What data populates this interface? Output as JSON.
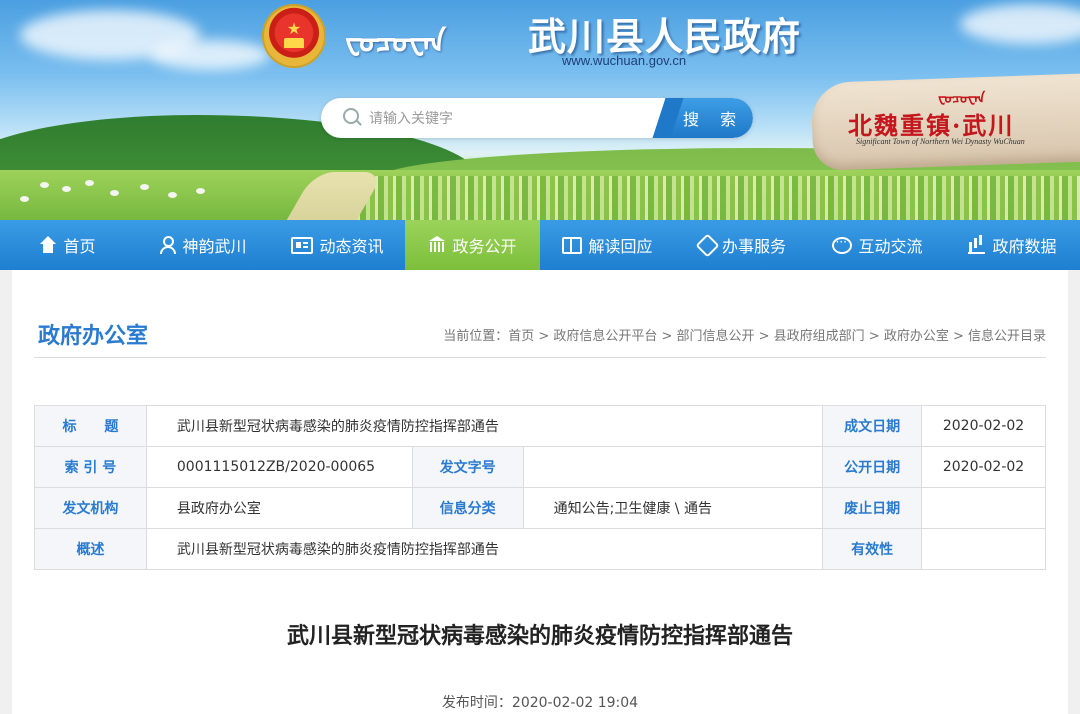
{
  "header": {
    "mongolian_title": "ᠸᠤᠴᠤᠸᠠᠨ",
    "site_title": "武川县人民政府",
    "site_url": "www.wuchuan.gov.cn",
    "search_placeholder": "请输入关键字",
    "search_button": "搜 索",
    "rock_title": "北魏重镇·武川",
    "rock_mongolian": "ᠸᠤᠴᠤᠸᠠᠨ",
    "rock_subtitle": "Significant Town of Northern Wei Dynasty WuChuan"
  },
  "nav": {
    "items": [
      {
        "label": "首页",
        "icon": "home-icon"
      },
      {
        "label": "神韵武川",
        "icon": "person-icon"
      },
      {
        "label": "动态资讯",
        "icon": "news-icon"
      },
      {
        "label": "政务公开",
        "icon": "government-icon"
      },
      {
        "label": "解读回应",
        "icon": "book-icon"
      },
      {
        "label": "办事服务",
        "icon": "handshake-icon"
      },
      {
        "label": "互动交流",
        "icon": "chat-icon"
      },
      {
        "label": "政府数据",
        "icon": "bar-chart-icon"
      }
    ],
    "active_index": 3
  },
  "page": {
    "section_title": "政府办公室",
    "breadcrumb": "当前位置：首页 > 政府信息公开平台 > 部门信息公开 > 县政府组成部门 > 政府办公室 > 信息公开目录"
  },
  "meta_table": {
    "title_label": "标　　题",
    "title_value": "武川县新型冠状病毒感染的肺炎疫情防控指挥部通告",
    "created_date_label": "成文日期",
    "created_date_value": "2020-02-02",
    "index_label": "索 引 号",
    "index_value": "0001115012ZB/2020-00065",
    "doc_number_label": "发文字号",
    "doc_number_value": "",
    "publish_date_label": "公开日期",
    "publish_date_value": "2020-02-02",
    "issuer_label": "发文机构",
    "issuer_value": "县政府办公室",
    "category_label": "信息分类",
    "category_value": "通知公告;卫生健康 \\ 通告",
    "expiry_label": "废止日期",
    "expiry_value": "",
    "summary_label": "概述",
    "summary_value": "武川县新型冠状病毒感染的肺炎疫情防控指挥部通告",
    "validity_label": "有效性",
    "validity_value": ""
  },
  "article": {
    "title": "武川县新型冠状病毒感染的肺炎疫情防控指挥部通告",
    "publish_time": "发布时间：2020-02-02 19:04"
  },
  "colors": {
    "nav_blue": "#1f7fd0",
    "nav_active_green": "#7cbf3b",
    "label_blue": "#2a7bd0"
  }
}
